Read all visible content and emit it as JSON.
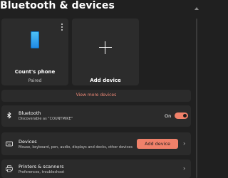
{
  "page": {
    "title": "Bluetooth & devices"
  },
  "device_cards": [
    {
      "name": "Count's phone",
      "status": "Paired",
      "icon": "phone-icon"
    }
  ],
  "add_card": {
    "label": "Add device",
    "icon": "plus-icon"
  },
  "view_more": {
    "label": "View more devices"
  },
  "bluetooth_row": {
    "title": "Bluetooth",
    "subtitle": "Discoverable as \"COUNTMIKE\"",
    "toggle_state_label": "On",
    "toggle_on": true,
    "icon": "bluetooth-icon"
  },
  "devices_row": {
    "title": "Devices",
    "subtitle": "Mouse, keyboard, pen, audio, displays and docks, other devices",
    "button_label": "Add device",
    "icon": "keyboard-icon"
  },
  "printers_row": {
    "title": "Printers & scanners",
    "subtitle": "Preferences, troubleshoot",
    "icon": "printer-icon"
  },
  "colors": {
    "accent": "#f0816a",
    "background": "#202020",
    "card": "#2c2c2c"
  }
}
